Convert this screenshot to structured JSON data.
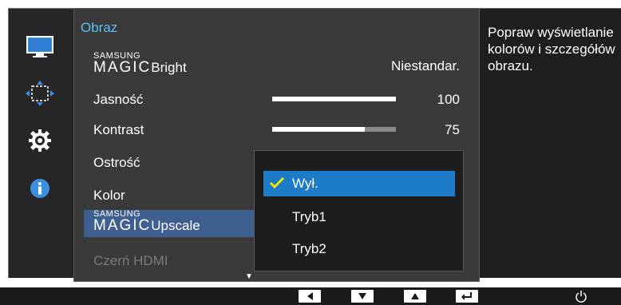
{
  "sidebar": {
    "icons": [
      "monitor-icon",
      "position-icon",
      "settings-gear-icon",
      "info-icon"
    ]
  },
  "menu": {
    "title": "Obraz",
    "items": [
      {
        "brand_top": "SAMSUNG",
        "brand_bottom": "MAGIC",
        "label": "Bright",
        "value": "Niestandar."
      },
      {
        "label": "Jasność",
        "value": "100",
        "level": 1.0
      },
      {
        "label": "Kontrast",
        "value": "75",
        "level": 0.75
      },
      {
        "label": "Ostrość"
      },
      {
        "label": "Kolor"
      },
      {
        "brand_top": "SAMSUNG",
        "brand_bottom": "MAGIC",
        "label": "Upscale"
      },
      {
        "label": "Czerń HDMI"
      }
    ],
    "scroll_indicator": "▼"
  },
  "dropdown": {
    "options": [
      "Wył.",
      "Tryb1",
      "Tryb2"
    ],
    "selected": "Wył.",
    "check_color": "#f2e900"
  },
  "help_text": "Popraw wyświetlanie kolorów i szczegółów obrazu.",
  "bottom_bar": {
    "buttons": [
      "left-arrow-icon",
      "down-arrow-icon",
      "up-arrow-icon",
      "enter-icon",
      "power-icon"
    ]
  },
  "colors": {
    "accent_title": "#5fbff7",
    "selected_row": "#3e5f8f",
    "selected_option": "#1e7bc8"
  }
}
